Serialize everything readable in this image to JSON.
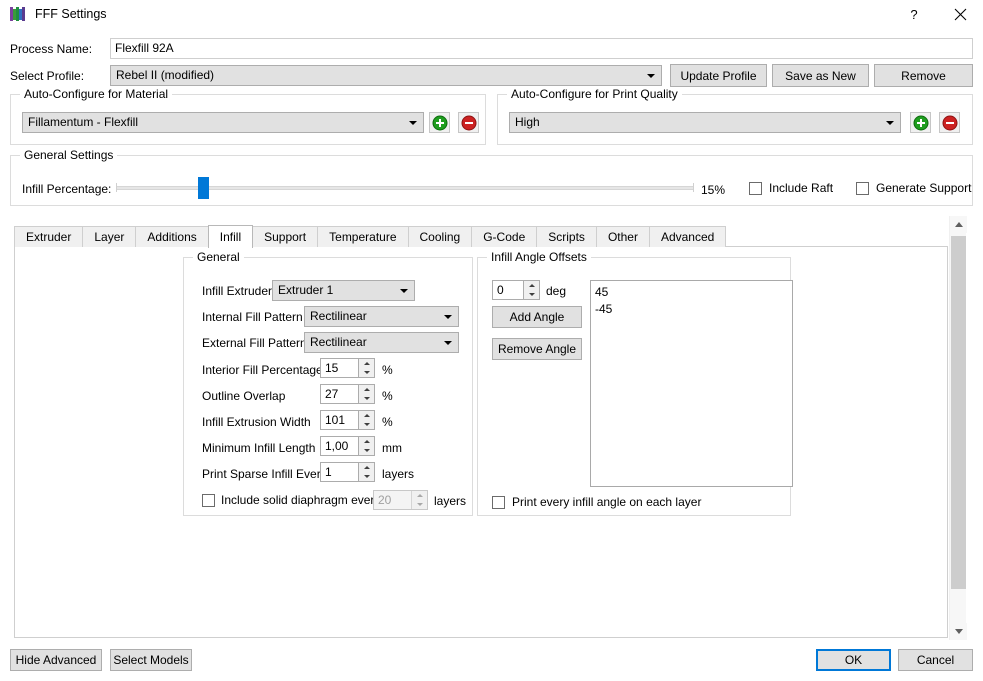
{
  "window": {
    "title": "FFF Settings",
    "icon": "fff-logo-icon",
    "help_label": "?",
    "close_label": "✕"
  },
  "header": {
    "process_name_label": "Process Name:",
    "process_name_value": "Flexfill 92A",
    "select_profile_label": "Select Profile:",
    "select_profile_value": "Rebel II (modified)",
    "update_profile_label": "Update Profile",
    "save_as_new_label": "Save as New",
    "remove_label": "Remove"
  },
  "material_group": {
    "title": "Auto-Configure for Material",
    "combo_value": "Fillamentum - Flexfill",
    "add_icon": "plus-circle-icon",
    "remove_icon": "minus-circle-icon"
  },
  "quality_group": {
    "title": "Auto-Configure for Print Quality",
    "combo_value": "High",
    "add_icon": "plus-circle-icon",
    "remove_icon": "minus-circle-icon"
  },
  "general_settings": {
    "title": "General Settings",
    "infill_label": "Infill Percentage:",
    "infill_value": "15%",
    "infill_percent": 15,
    "include_raft_label": "Include Raft",
    "include_raft_checked": false,
    "generate_support_label": "Generate Support",
    "generate_support_checked": false
  },
  "tabs": [
    {
      "label": "Extruder",
      "active": false
    },
    {
      "label": "Layer",
      "active": false
    },
    {
      "label": "Additions",
      "active": false
    },
    {
      "label": "Infill",
      "active": true
    },
    {
      "label": "Support",
      "active": false
    },
    {
      "label": "Temperature",
      "active": false
    },
    {
      "label": "Cooling",
      "active": false
    },
    {
      "label": "G-Code",
      "active": false
    },
    {
      "label": "Scripts",
      "active": false
    },
    {
      "label": "Other",
      "active": false
    },
    {
      "label": "Advanced",
      "active": false
    }
  ],
  "infill_general": {
    "title": "General",
    "infill_extruder_label": "Infill Extruder",
    "infill_extruder_value": "Extruder 1",
    "internal_fill_label": "Internal Fill Pattern",
    "internal_fill_value": "Rectilinear",
    "external_fill_label": "External Fill Pattern",
    "external_fill_value": "Rectilinear",
    "interior_fill_label": "Interior Fill Percentage",
    "interior_fill_value": "15",
    "interior_fill_unit": "%",
    "outline_overlap_label": "Outline Overlap",
    "outline_overlap_value": "27",
    "outline_overlap_unit": "%",
    "extrusion_width_label": "Infill Extrusion Width",
    "extrusion_width_value": "101",
    "extrusion_width_unit": "%",
    "min_infill_label": "Minimum Infill Length",
    "min_infill_value": "1,00",
    "min_infill_unit": "mm",
    "sparse_infill_label": "Print Sparse Infill Every",
    "sparse_infill_value": "1",
    "sparse_infill_unit": "layers",
    "diaphragm_label": "Include solid diaphragm every",
    "diaphragm_checked": false,
    "diaphragm_value": "20",
    "diaphragm_unit": "layers"
  },
  "infill_angles": {
    "title": "Infill Angle Offsets",
    "angle_value": "0",
    "deg_label": "deg",
    "add_angle_label": "Add Angle",
    "remove_angle_label": "Remove Angle",
    "angles": [
      "45",
      "-45"
    ],
    "print_every_angle_label": "Print every infill angle on each layer",
    "print_every_angle_checked": false
  },
  "footer": {
    "hide_advanced_label": "Hide Advanced",
    "select_models_label": "Select Models",
    "ok_label": "OK",
    "cancel_label": "Cancel"
  },
  "colors": {
    "accent": "#0078d7",
    "add": "#2aa02a",
    "remove": "#cc2222",
    "control_face": "#e1e1e1"
  }
}
